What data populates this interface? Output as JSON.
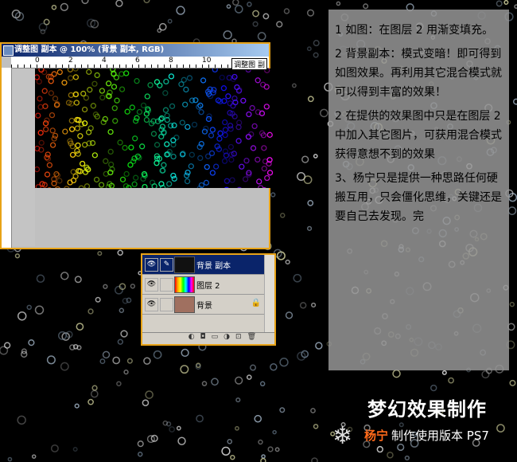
{
  "window": {
    "title": "调整图 副本 @ 100% (背景 副本, RGB)",
    "ruler_labels": [
      "0",
      "2",
      "4",
      "6",
      "8",
      "10"
    ],
    "doc_tag": "调整图 副"
  },
  "layers": [
    {
      "name": "背景 副本",
      "selected": true
    },
    {
      "name": "图层 2",
      "selected": false
    },
    {
      "name": "背景",
      "selected": false,
      "locked": true
    }
  ],
  "layer_toolbar": "◐◘▭◑⊡🗑",
  "panel": {
    "paragraphs": [
      "1 如图：在图层 2 用渐变填充。",
      "2 背景副本：模式变暗！即可得到如图效果。再利用其它混合模式就可以得到丰富的效果！",
      "2 在提供的效果图中只是在图层 2 中加入其它图片，可获用混合模式获得意想不到的效果",
      "3、杨宁只是提供一种思路任何硬搬互用，只会僵化思维，关键还是要自己去发现。完"
    ]
  },
  "footer": {
    "title": "梦幻效果制作",
    "author": "杨宁",
    "subtitle": "制作使用版本 PS7"
  }
}
